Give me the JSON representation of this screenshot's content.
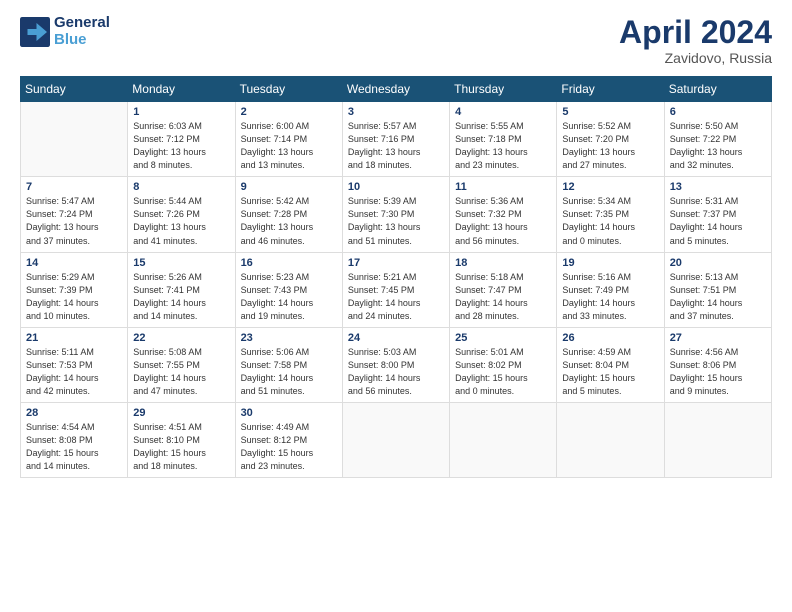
{
  "header": {
    "logo_line1": "General",
    "logo_line2": "Blue",
    "month": "April 2024",
    "location": "Zavidovo, Russia"
  },
  "weekdays": [
    "Sunday",
    "Monday",
    "Tuesday",
    "Wednesday",
    "Thursday",
    "Friday",
    "Saturday"
  ],
  "weeks": [
    [
      {
        "num": "",
        "info": ""
      },
      {
        "num": "1",
        "info": "Sunrise: 6:03 AM\nSunset: 7:12 PM\nDaylight: 13 hours\nand 8 minutes."
      },
      {
        "num": "2",
        "info": "Sunrise: 6:00 AM\nSunset: 7:14 PM\nDaylight: 13 hours\nand 13 minutes."
      },
      {
        "num": "3",
        "info": "Sunrise: 5:57 AM\nSunset: 7:16 PM\nDaylight: 13 hours\nand 18 minutes."
      },
      {
        "num": "4",
        "info": "Sunrise: 5:55 AM\nSunset: 7:18 PM\nDaylight: 13 hours\nand 23 minutes."
      },
      {
        "num": "5",
        "info": "Sunrise: 5:52 AM\nSunset: 7:20 PM\nDaylight: 13 hours\nand 27 minutes."
      },
      {
        "num": "6",
        "info": "Sunrise: 5:50 AM\nSunset: 7:22 PM\nDaylight: 13 hours\nand 32 minutes."
      }
    ],
    [
      {
        "num": "7",
        "info": "Sunrise: 5:47 AM\nSunset: 7:24 PM\nDaylight: 13 hours\nand 37 minutes."
      },
      {
        "num": "8",
        "info": "Sunrise: 5:44 AM\nSunset: 7:26 PM\nDaylight: 13 hours\nand 41 minutes."
      },
      {
        "num": "9",
        "info": "Sunrise: 5:42 AM\nSunset: 7:28 PM\nDaylight: 13 hours\nand 46 minutes."
      },
      {
        "num": "10",
        "info": "Sunrise: 5:39 AM\nSunset: 7:30 PM\nDaylight: 13 hours\nand 51 minutes."
      },
      {
        "num": "11",
        "info": "Sunrise: 5:36 AM\nSunset: 7:32 PM\nDaylight: 13 hours\nand 56 minutes."
      },
      {
        "num": "12",
        "info": "Sunrise: 5:34 AM\nSunset: 7:35 PM\nDaylight: 14 hours\nand 0 minutes."
      },
      {
        "num": "13",
        "info": "Sunrise: 5:31 AM\nSunset: 7:37 PM\nDaylight: 14 hours\nand 5 minutes."
      }
    ],
    [
      {
        "num": "14",
        "info": "Sunrise: 5:29 AM\nSunset: 7:39 PM\nDaylight: 14 hours\nand 10 minutes."
      },
      {
        "num": "15",
        "info": "Sunrise: 5:26 AM\nSunset: 7:41 PM\nDaylight: 14 hours\nand 14 minutes."
      },
      {
        "num": "16",
        "info": "Sunrise: 5:23 AM\nSunset: 7:43 PM\nDaylight: 14 hours\nand 19 minutes."
      },
      {
        "num": "17",
        "info": "Sunrise: 5:21 AM\nSunset: 7:45 PM\nDaylight: 14 hours\nand 24 minutes."
      },
      {
        "num": "18",
        "info": "Sunrise: 5:18 AM\nSunset: 7:47 PM\nDaylight: 14 hours\nand 28 minutes."
      },
      {
        "num": "19",
        "info": "Sunrise: 5:16 AM\nSunset: 7:49 PM\nDaylight: 14 hours\nand 33 minutes."
      },
      {
        "num": "20",
        "info": "Sunrise: 5:13 AM\nSunset: 7:51 PM\nDaylight: 14 hours\nand 37 minutes."
      }
    ],
    [
      {
        "num": "21",
        "info": "Sunrise: 5:11 AM\nSunset: 7:53 PM\nDaylight: 14 hours\nand 42 minutes."
      },
      {
        "num": "22",
        "info": "Sunrise: 5:08 AM\nSunset: 7:55 PM\nDaylight: 14 hours\nand 47 minutes."
      },
      {
        "num": "23",
        "info": "Sunrise: 5:06 AM\nSunset: 7:58 PM\nDaylight: 14 hours\nand 51 minutes."
      },
      {
        "num": "24",
        "info": "Sunrise: 5:03 AM\nSunset: 8:00 PM\nDaylight: 14 hours\nand 56 minutes."
      },
      {
        "num": "25",
        "info": "Sunrise: 5:01 AM\nSunset: 8:02 PM\nDaylight: 15 hours\nand 0 minutes."
      },
      {
        "num": "26",
        "info": "Sunrise: 4:59 AM\nSunset: 8:04 PM\nDaylight: 15 hours\nand 5 minutes."
      },
      {
        "num": "27",
        "info": "Sunrise: 4:56 AM\nSunset: 8:06 PM\nDaylight: 15 hours\nand 9 minutes."
      }
    ],
    [
      {
        "num": "28",
        "info": "Sunrise: 4:54 AM\nSunset: 8:08 PM\nDaylight: 15 hours\nand 14 minutes."
      },
      {
        "num": "29",
        "info": "Sunrise: 4:51 AM\nSunset: 8:10 PM\nDaylight: 15 hours\nand 18 minutes."
      },
      {
        "num": "30",
        "info": "Sunrise: 4:49 AM\nSunset: 8:12 PM\nDaylight: 15 hours\nand 23 minutes."
      },
      {
        "num": "",
        "info": ""
      },
      {
        "num": "",
        "info": ""
      },
      {
        "num": "",
        "info": ""
      },
      {
        "num": "",
        "info": ""
      }
    ]
  ]
}
